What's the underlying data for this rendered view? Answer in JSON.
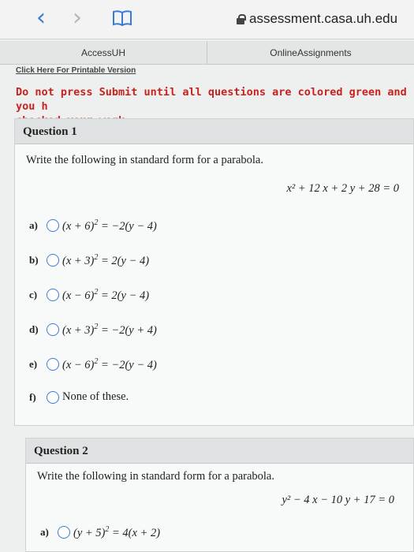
{
  "browser": {
    "url": "assessment.casa.uh.edu"
  },
  "site_tabs": [
    "AccessUH",
    "OnlineAssignments"
  ],
  "printable_link": "Click Here For Printable Version",
  "warning": "Do not press Submit until all questions are colored green and you h\nchecked your work.",
  "question1": {
    "title": "Question 1",
    "prompt": "Write the following in standard form for a parabola.",
    "given": "x² + 12 x + 2 y + 28 = 0",
    "choices": [
      {
        "label": "a)",
        "base": "(x + 6)",
        "rest": " = −2(y − 4)"
      },
      {
        "label": "b)",
        "base": "(x + 3)",
        "rest": " = 2(y − 4)"
      },
      {
        "label": "c)",
        "base": "(x − 6)",
        "rest": " = 2(y − 4)"
      },
      {
        "label": "d)",
        "base": "(x + 3)",
        "rest": " = −2(y + 4)"
      },
      {
        "label": "e)",
        "base": "(x − 6)",
        "rest": " = −2(y − 4)"
      },
      {
        "label": "f)",
        "text": "None of these."
      }
    ]
  },
  "question2": {
    "title": "Question 2",
    "prompt": "Write the following in standard form for a parabola.",
    "given": "y² − 4 x − 10 y + 17 = 0",
    "choices": [
      {
        "label": "a)",
        "base": "(y + 5)",
        "rest": " = 4(x + 2)"
      }
    ]
  },
  "exponent": "2"
}
